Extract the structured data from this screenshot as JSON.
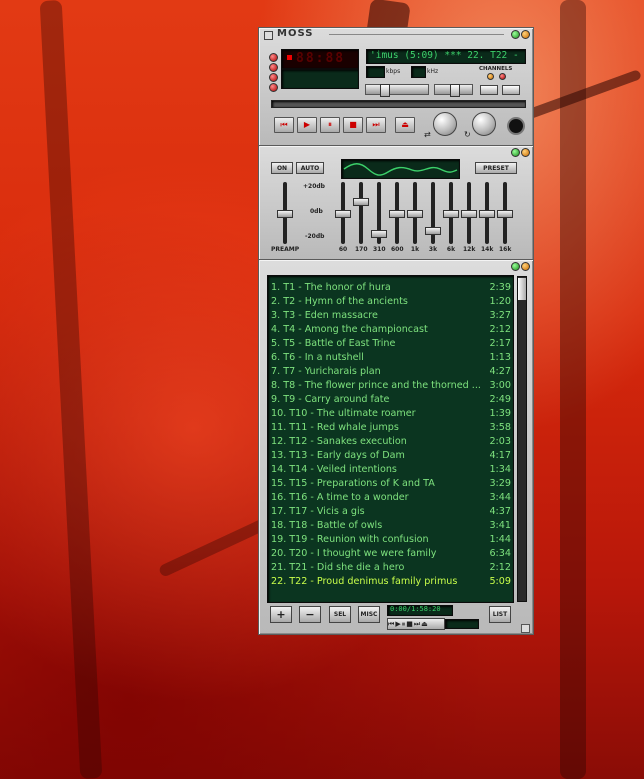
{
  "player": {
    "title": "MOSS",
    "time_display": "88:88",
    "marquee": "'imus (5:09)  ***  22. T22 - Proud",
    "kbps_label": "kbps",
    "khz_label": "kHz",
    "channels_label": "CHANNELS",
    "transport_icons": [
      "prev-icon",
      "play-icon",
      "pause-icon",
      "stop-icon",
      "next-icon",
      "eject-icon"
    ]
  },
  "equalizer": {
    "on_label": "ON",
    "auto_label": "AUTO",
    "preset_label": "PRESET",
    "db_top": "+20db",
    "db_mid": "0db",
    "db_bottom": "-20db",
    "preamp_label": "PREAMP",
    "preamp_level": 0.5,
    "bands": [
      {
        "label": "60",
        "level": 0.5
      },
      {
        "label": "170",
        "level": 0.72
      },
      {
        "label": "310",
        "level": 0.15
      },
      {
        "label": "600",
        "level": 0.5
      },
      {
        "label": "1k",
        "level": 0.5
      },
      {
        "label": "3k",
        "level": 0.2
      },
      {
        "label": "6k",
        "level": 0.5
      },
      {
        "label": "12k",
        "level": 0.5
      },
      {
        "label": "14k",
        "level": 0.5
      },
      {
        "label": "16k",
        "level": 0.5
      }
    ]
  },
  "playlist": {
    "items": [
      {
        "title": "1. T1 - The honor of hura",
        "duration": "2:39"
      },
      {
        "title": "2. T2 - Hymn of the ancients",
        "duration": "1:20"
      },
      {
        "title": "3. T3 - Eden massacre",
        "duration": "3:27"
      },
      {
        "title": "4. T4 - Among the championcast",
        "duration": "2:12"
      },
      {
        "title": "5. T5 - Battle of East Trine",
        "duration": "2:17"
      },
      {
        "title": "6. T6 - In a nutshell",
        "duration": "1:13"
      },
      {
        "title": "7. T7 - Yuricharais plan",
        "duration": "4:27"
      },
      {
        "title": "8. T8 - The flower prince and the thorned ...",
        "duration": "3:00"
      },
      {
        "title": "9. T9 - Carry around fate",
        "duration": "2:49"
      },
      {
        "title": "10. T10 - The ultimate roamer",
        "duration": "1:39"
      },
      {
        "title": "11. T11 - Red whale jumps",
        "duration": "3:58"
      },
      {
        "title": "12. T12 - Sanakes execution",
        "duration": "2:03"
      },
      {
        "title": "13. T13 - Early days of Dam",
        "duration": "4:17"
      },
      {
        "title": "14. T14 - Veiled intentions",
        "duration": "1:34"
      },
      {
        "title": "15. T15 - Preparations of K and TA",
        "duration": "3:29"
      },
      {
        "title": "16. T16 - A time to a wonder",
        "duration": "3:44"
      },
      {
        "title": "17. T17 - Vicis a gis",
        "duration": "4:37"
      },
      {
        "title": "18. T18 - Battle of owls",
        "duration": "3:41"
      },
      {
        "title": "19. T19 - Reunion with confusion",
        "duration": "1:44"
      },
      {
        "title": "20. T20 - I thought we were family",
        "duration": "6:34"
      },
      {
        "title": "21. T21 - Did she die a hero",
        "duration": "2:12"
      },
      {
        "title": "22. T22 - Proud denimus family primus",
        "duration": "5:09"
      }
    ],
    "current_index": 21,
    "add_label": "+",
    "remove_label": "−",
    "sel_label": "SEL",
    "misc_label": "MISC",
    "list_label": "LIST",
    "time_info": "0:00/1:58:20"
  },
  "colors": {
    "accent": "#3cd06a",
    "current": "#c9ff4a",
    "lcd_bg": "#0a2a1a"
  }
}
